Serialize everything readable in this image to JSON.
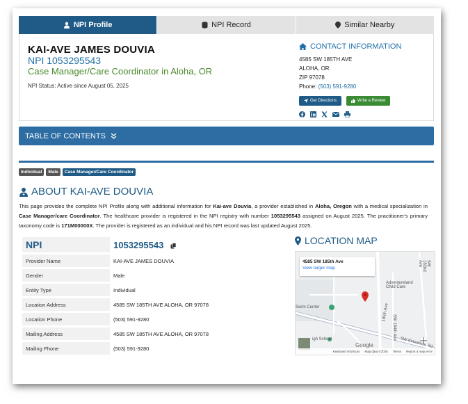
{
  "tabs": [
    {
      "label": "NPI Profile",
      "icon": "user-icon",
      "active": true
    },
    {
      "label": "NPI Record",
      "icon": "database-icon",
      "active": false
    },
    {
      "label": "Similar Nearby",
      "icon": "map-pin-icon",
      "active": false
    }
  ],
  "provider": {
    "name": "KAI-AVE JAMES DOUVIA",
    "npi_heading": "NPI 1053295543",
    "specialty_heading": "Case Manager/Care Coordinator in Aloha, OR",
    "status": "NPI Status: Active since August 05, 2025"
  },
  "contact": {
    "title": "CONTACT INFORMATION",
    "line1": "4585 SW 185TH AVE",
    "line2": "ALOHA, OR",
    "line3": "ZIP 97078",
    "phone_label": "Phone:",
    "phone": "(503) 591-9280",
    "directions_button": "Get Directions",
    "review_button": "Write a Review"
  },
  "socials": [
    "facebook-icon",
    "linkedin-icon",
    "x-icon",
    "email-icon",
    "print-icon"
  ],
  "toc": {
    "label": "TABLE OF CONTENTS"
  },
  "badges": [
    "Individual",
    "Male",
    "Case Manager/Care Coordinator"
  ],
  "about": {
    "title": "ABOUT KAI-AVE DOUVIA",
    "p1": "This page provides the complete NPI Profile along with additional information for ",
    "name_bold": "Kai-ave Douvia",
    "p2": ", a provider established in ",
    "place_bold": "Aloha, Oregon",
    "p3": " with a medical specialization in ",
    "spec_bold": "Case Manager/care Coordinator",
    "p4": ". The healthcare provider is registered in the NPI registry with number ",
    "npi_bold": "1053295543",
    "p5": " assigned on August 2025. The practitioner's primary taxonomy code is ",
    "tax_bold": "171M00000X",
    "p6": ". The provider is registered as an individual and his NPI record was last updated August 2025."
  },
  "table": {
    "npi_key": "NPI",
    "npi_value": "1053295543",
    "rows": [
      {
        "key": "Provider Name",
        "value": "KAI-AVE JAMES DOUVIA"
      },
      {
        "key": "Gender",
        "value": "Male"
      },
      {
        "key": "Entity Type",
        "value": "Individual"
      },
      {
        "key": "Location Address",
        "value": "4585 SW 185TH AVE ALOHA, OR 97078"
      },
      {
        "key": "Location Phone",
        "value": "(503) 591-9280"
      },
      {
        "key": "Mailing Address",
        "value": "4585 SW 185TH AVE ALOHA, OR 97078"
      },
      {
        "key": "Mailing Phone",
        "value": "(503) 591-9280"
      }
    ]
  },
  "map": {
    "title": "LOCATION MAP",
    "popup_title": "4585 SW 185th Ave",
    "popup_link": "View larger map",
    "label_child_care": "Adventureland Child Care",
    "label_swim": "Swim Center",
    "label_school": "igh School",
    "label_185": "185th Ave",
    "label_184": "SW 184th Ave",
    "label_182": "SW 182nd Ave",
    "label_kinnaman": "SW Kinnaman Rd",
    "label_google": "Google",
    "footer_shortcuts": "Keyboard shortcuts",
    "footer_data": "Map data ©2025",
    "footer_terms": "Terms",
    "footer_report": "Report a map error"
  }
}
